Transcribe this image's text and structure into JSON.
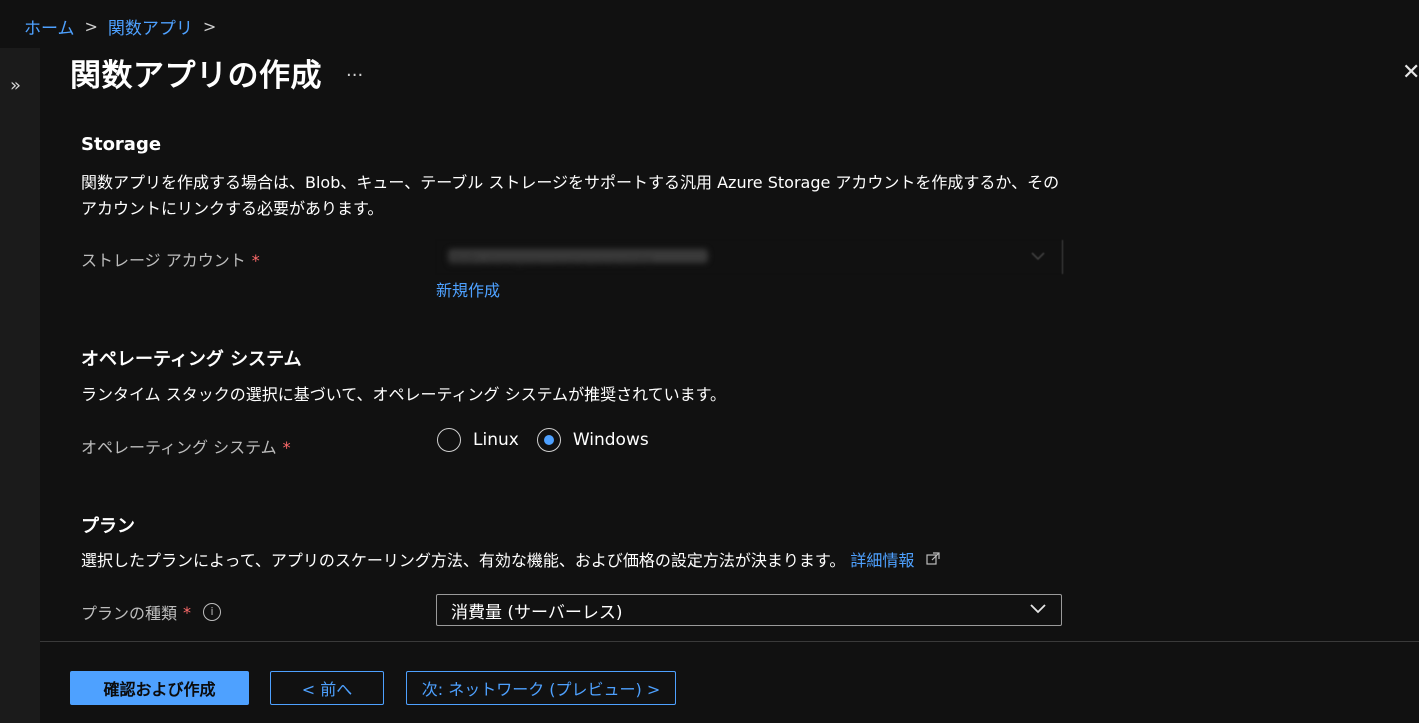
{
  "breadcrumb": {
    "home": "ホーム",
    "function_app": "関数アプリ",
    "sep": ">"
  },
  "page": {
    "title": "関数アプリの作成",
    "more": "...",
    "close": "✕",
    "expand": "»"
  },
  "storage": {
    "title": "Storage",
    "description": "関数アプリを作成する場合は、Blob、キュー、テーブル ストレージをサポートする汎用 Azure Storage アカウントを作成するか、そのアカウントにリンクする必要があります。",
    "account_label": "ストレージ アカウント",
    "account_value": "(新規) storageaccountresourceb84",
    "new_link": "新規作成"
  },
  "os": {
    "title": "オペレーティング システム",
    "description": "ランタイム スタックの選択に基づいて、オペレーティング システムが推奨されています。",
    "label": "オペレーティング システム",
    "options": [
      "Linux",
      "Windows"
    ],
    "selected": "Windows"
  },
  "plan": {
    "title": "プラン",
    "description": "選択したプランによって、アプリのスケーリング方法、有効な機能、および価格の設定方法が決まります。",
    "details_link": "詳細情報",
    "type_label": "プランの種類",
    "type_value": "消費量 (サーバーレス)"
  },
  "required_mark": "*",
  "buttons": {
    "review_create": "確認および作成",
    "prev": "< 前へ",
    "next": "次: ネットワーク (プレビュー) >"
  },
  "colors": {
    "accent": "#4ea1ff",
    "required": "#ff6b6b",
    "background": "#111111"
  },
  "icons": {
    "info": "info-icon",
    "external_link": "external-link-icon",
    "chevron_down": "chevron-down-icon"
  }
}
